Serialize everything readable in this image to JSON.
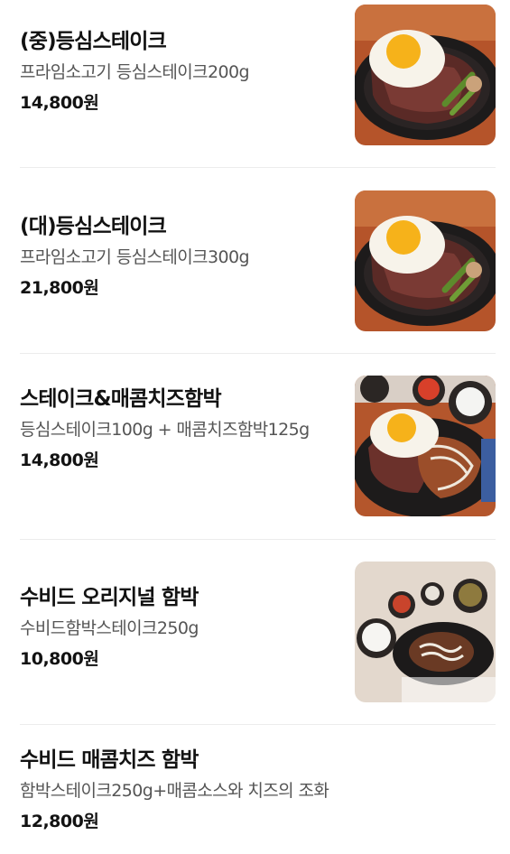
{
  "menu": {
    "items": [
      {
        "name": "(중)등심스테이크",
        "description": "프라임소고기 등심스테이크200g",
        "price": "14,800원",
        "image_icon": "steak-with-egg-photo"
      },
      {
        "name": "(대)등심스테이크",
        "description": "프라임소고기 등심스테이크300g",
        "price": "21,800원",
        "image_icon": "steak-with-egg-photo"
      },
      {
        "name": "스테이크&매콤치즈함박",
        "description": "등심스테이크100g + 매콤치즈함박125g",
        "price": "14,800원",
        "image_icon": "steak-hamburg-combo-photo"
      },
      {
        "name": "수비드 오리지널 함박",
        "description": "수비드함박스테이크250g",
        "price": "10,800원",
        "image_icon": "hamburg-steak-set-photo"
      },
      {
        "name": "수비드 매콤치즈 함박",
        "description": "함박스테이크250g+매콤소스와 치즈의 조화",
        "price": "12,800원",
        "image_icon": ""
      }
    ]
  }
}
